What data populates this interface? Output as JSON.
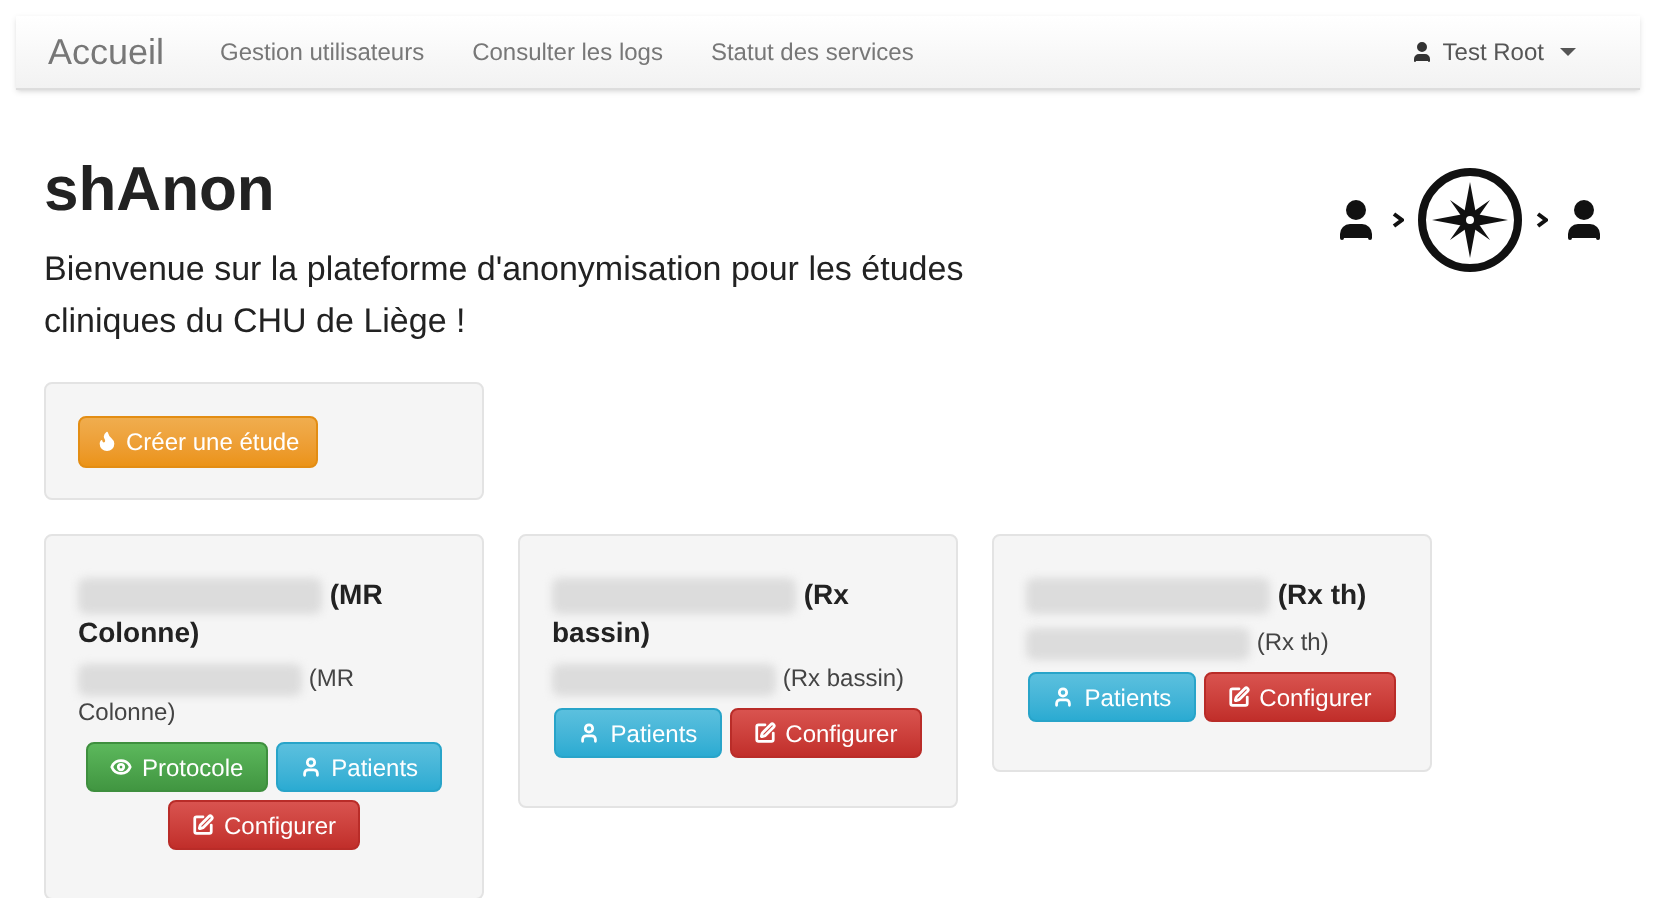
{
  "navbar": {
    "brand": "Accueil",
    "links": [
      {
        "label": "Gestion utilisateurs"
      },
      {
        "label": "Consulter les logs"
      },
      {
        "label": "Statut des services"
      }
    ],
    "user": "Test Root"
  },
  "title": "shAnon",
  "intro": "Bienvenue sur la plateforme d'anonymisation pour les études cliniques du CHU de Liège !",
  "create_button": "Créer une étude",
  "studies": [
    {
      "title": "(MR Colonne)",
      "subtitle": "(MR Colonne)",
      "buttons": [
        {
          "kind": "protocol",
          "label": "Protocole"
        },
        {
          "kind": "patients",
          "label": "Patients"
        },
        {
          "kind": "configure",
          "label": "Configurer"
        }
      ]
    },
    {
      "title": "(Rx bassin)",
      "subtitle": "(Rx bassin)",
      "buttons": [
        {
          "kind": "patients",
          "label": "Patients"
        },
        {
          "kind": "configure",
          "label": "Configurer"
        }
      ]
    },
    {
      "title": "(Rx th)",
      "subtitle": "(Rx th)",
      "buttons": [
        {
          "kind": "patients",
          "label": "Patients"
        },
        {
          "kind": "configure",
          "label": "Configurer"
        }
      ]
    }
  ]
}
